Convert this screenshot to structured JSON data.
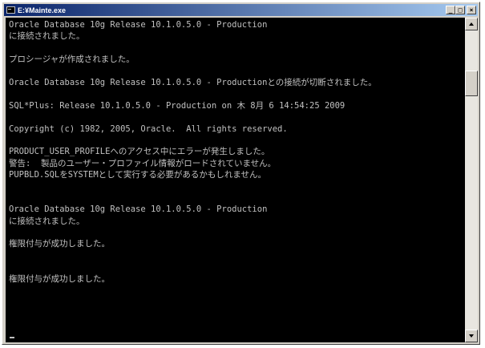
{
  "window": {
    "title": "E:¥Mainte.exe",
    "minimize_glyph": "_",
    "maximize_glyph": "□",
    "close_glyph": "×",
    "icon": "console-window-icon"
  },
  "console": {
    "lines": [
      "Oracle Database 10g Release 10.1.0.5.0 - Production",
      "に接続されました。",
      "",
      "プロシージャが作成されました。",
      "",
      "Oracle Database 10g Release 10.1.0.5.0 - Productionとの接続が切断されました。",
      "",
      "SQL*Plus: Release 10.1.0.5.0 - Production on 木 8月 6 14:54:25 2009",
      "",
      "Copyright (c) 1982, 2005, Oracle.  All rights reserved.",
      "",
      "PRODUCT_USER_PROFILEへのアクセス中にエラーが発生しました。",
      "警告:  製品のユーザー・プロファイル情報がロードされていません。",
      "PUPBLD.SQLをSYSTEMとして実行する必要があるかもしれません。",
      "",
      "",
      "Oracle Database 10g Release 10.1.0.5.0 - Production",
      "に接続されました。",
      "",
      "権限付与が成功しました。",
      "",
      "",
      "権限付与が成功しました。"
    ]
  },
  "colors": {
    "console_bg": "#000000",
    "console_text": "#c0c0c0",
    "titlebar_start": "#0a246a",
    "titlebar_end": "#a6caf0",
    "chrome": "#d4d0c8"
  }
}
